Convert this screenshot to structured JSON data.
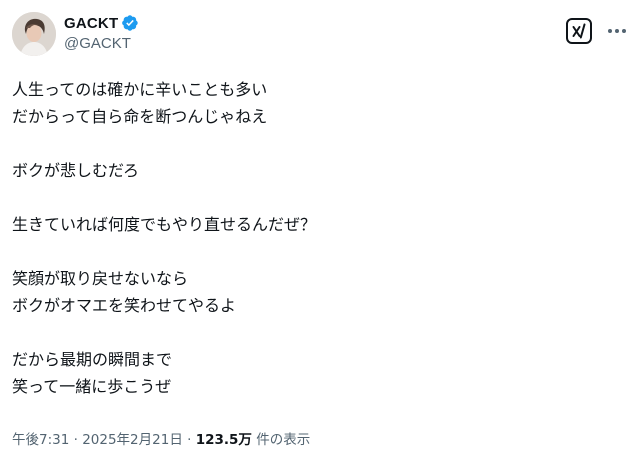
{
  "author": {
    "display_name": "GACKT",
    "handle": "@GACKT",
    "verified": true
  },
  "tweet": {
    "lines": [
      "人生ってのは確かに辛いことも多い",
      "だからって自ら命を断つんじゃねえ",
      "",
      "ボクが悲しむだろ",
      "",
      "生きていれば何度でもやり直せるんだぜ？",
      "",
      "笑顔が取り戻せないなら",
      "ボクがオマエを笑わせてやるよ",
      "",
      "だから最期の瞬間まで",
      "笑って一緒に歩こうぜ"
    ]
  },
  "meta": {
    "time": "午後7:31",
    "separator": " · ",
    "date": "2025年2月21日",
    "views_count": "123.5万",
    "views_label": " 件の表示"
  },
  "icons": {
    "verified": "verified-badge-icon",
    "grok": "grok-icon",
    "more": "more-icon"
  },
  "colors": {
    "text_primary": "#0f1419",
    "text_secondary": "#536471",
    "verified_blue": "#1d9bf0"
  }
}
